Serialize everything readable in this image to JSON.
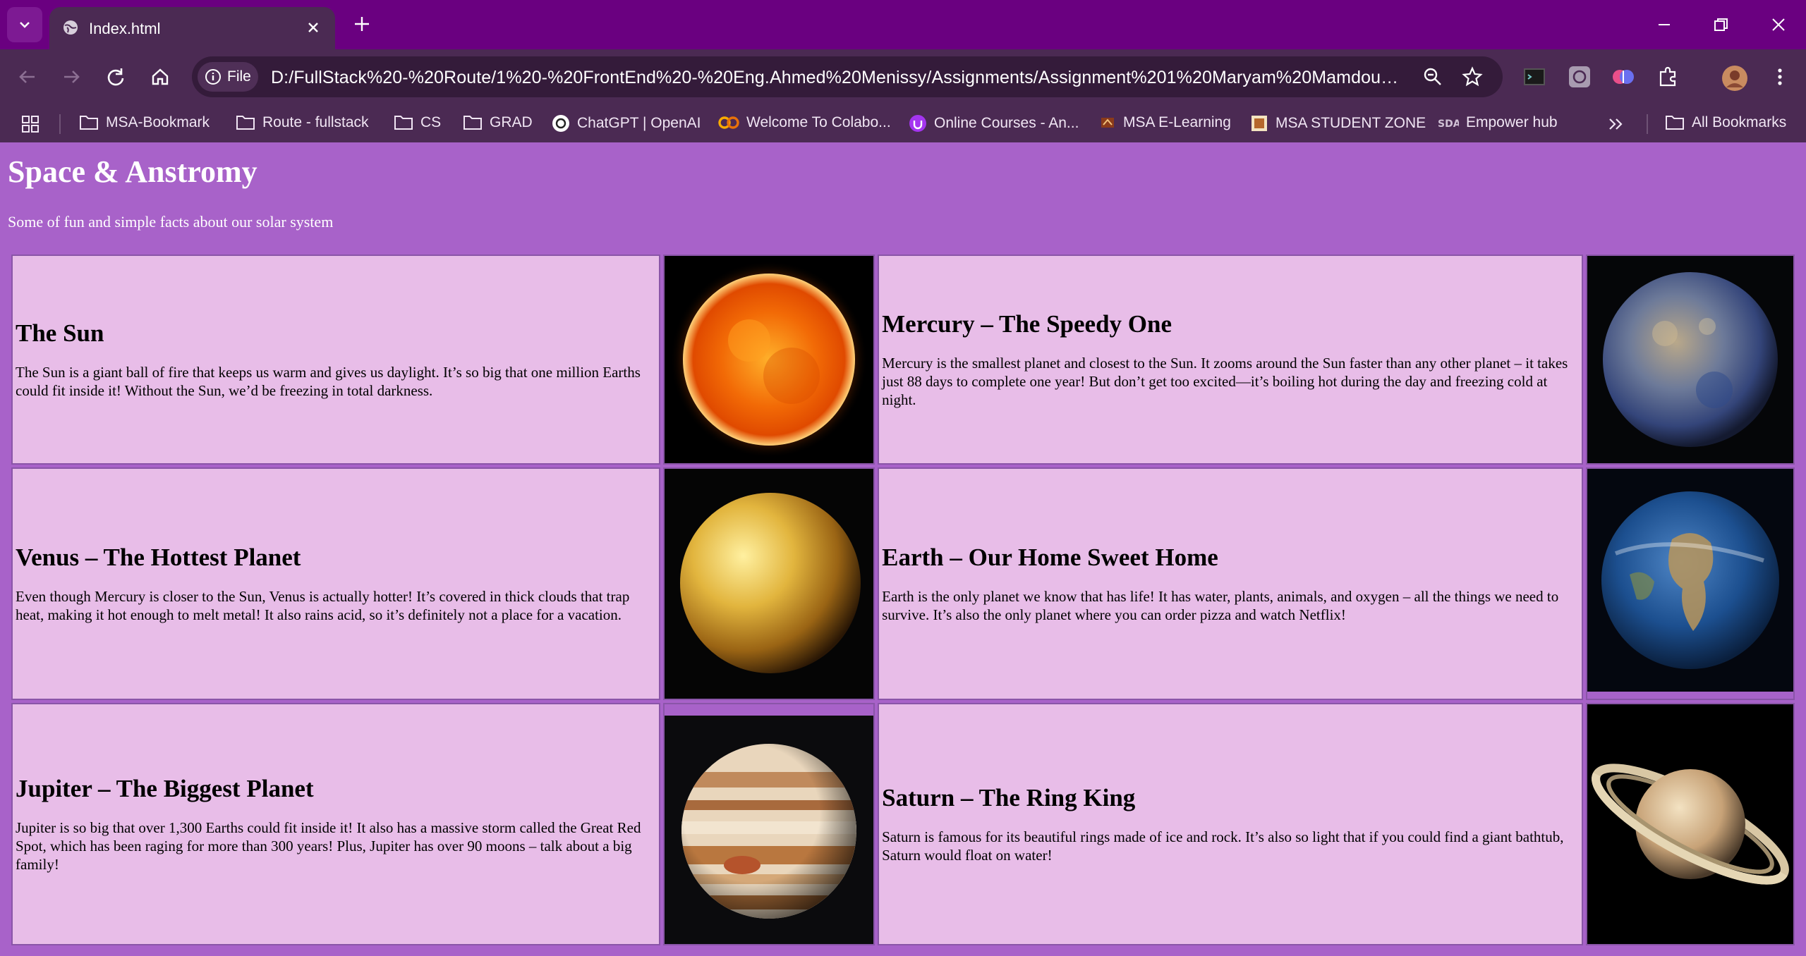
{
  "browser": {
    "tab_title": "Index.html",
    "url_chip": "File",
    "url": "D:/FullStack%20-%20Route/1%20-%20FrontEnd%20-%20Eng.Ahmed%20Menissy/Assignments/Assignment%201%20Maryam%20Mamdouh%20Sa...",
    "bookmarks": [
      {
        "label": "MSA-Bookmark",
        "icon": "folder-icon"
      },
      {
        "label": "Route - fullstack",
        "icon": "folder-icon"
      },
      {
        "label": "CS",
        "icon": "folder-icon"
      },
      {
        "label": "GRAD",
        "icon": "folder-icon"
      },
      {
        "label": "ChatGPT | OpenAI",
        "icon": "openai-icon"
      },
      {
        "label": "Welcome To Colabo...",
        "icon": "colab-icon"
      },
      {
        "label": "Online Courses - An...",
        "icon": "udemy-icon"
      },
      {
        "label": "MSA E-Learning",
        "icon": "msa-icon"
      },
      {
        "label": "MSA STUDENT ZONE",
        "icon": "msa-zone-icon"
      },
      {
        "label": "Empower hub",
        "icon": "sda-icon"
      }
    ],
    "all_bookmarks": "All Bookmarks"
  },
  "page": {
    "title": "Space & Anstromy",
    "subtitle": "Some of fun and simple facts about our solar system",
    "rows": [
      {
        "left": {
          "heading": "The Sun",
          "text": "The Sun is a giant ball of fire that keeps us warm and gives us daylight. It’s so big that one million Earths could fit inside it! Without the Sun, we’d be freezing in total darkness.",
          "image": "sun"
        },
        "right": {
          "heading": "Mercury – The Speedy One",
          "text": "Mercury is the smallest planet and closest to the Sun. It zooms around the Sun faster than any other planet – it takes just 88 days to complete one year! But don’t get too excited—it’s boiling hot during the day and freezing cold at night.",
          "image": "mercury"
        }
      },
      {
        "left": {
          "heading": "Venus – The Hottest Planet",
          "text": "Even though Mercury is closer to the Sun, Venus is actually hotter! It’s covered in thick clouds that trap heat, making it hot enough to melt metal! It also rains acid, so it’s definitely not a place for a vacation.",
          "image": "venus"
        },
        "right": {
          "heading": "Earth – Our Home Sweet Home",
          "text": "Earth is the only planet we know that has life! It has water, plants, animals, and oxygen – all the things we need to survive. It’s also the only planet where you can order pizza and watch Netflix!",
          "image": "earth"
        }
      },
      {
        "left": {
          "heading": "Jupiter – The Biggest Planet",
          "text": "Jupiter is so big that over 1,300 Earths could fit inside it! It also has a massive storm called the Great Red Spot, which has been raging for more than 300 years! Plus, Jupiter has over 90 moons – talk about a big family!",
          "image": "jupiter"
        },
        "right": {
          "heading": "Saturn – The Ring King",
          "text": "Saturn is famous for its beautiful rings made of ice and rock. It’s also so light that if you could find a giant bathtub, Saturn would float on water!",
          "image": "saturn"
        }
      }
    ]
  }
}
